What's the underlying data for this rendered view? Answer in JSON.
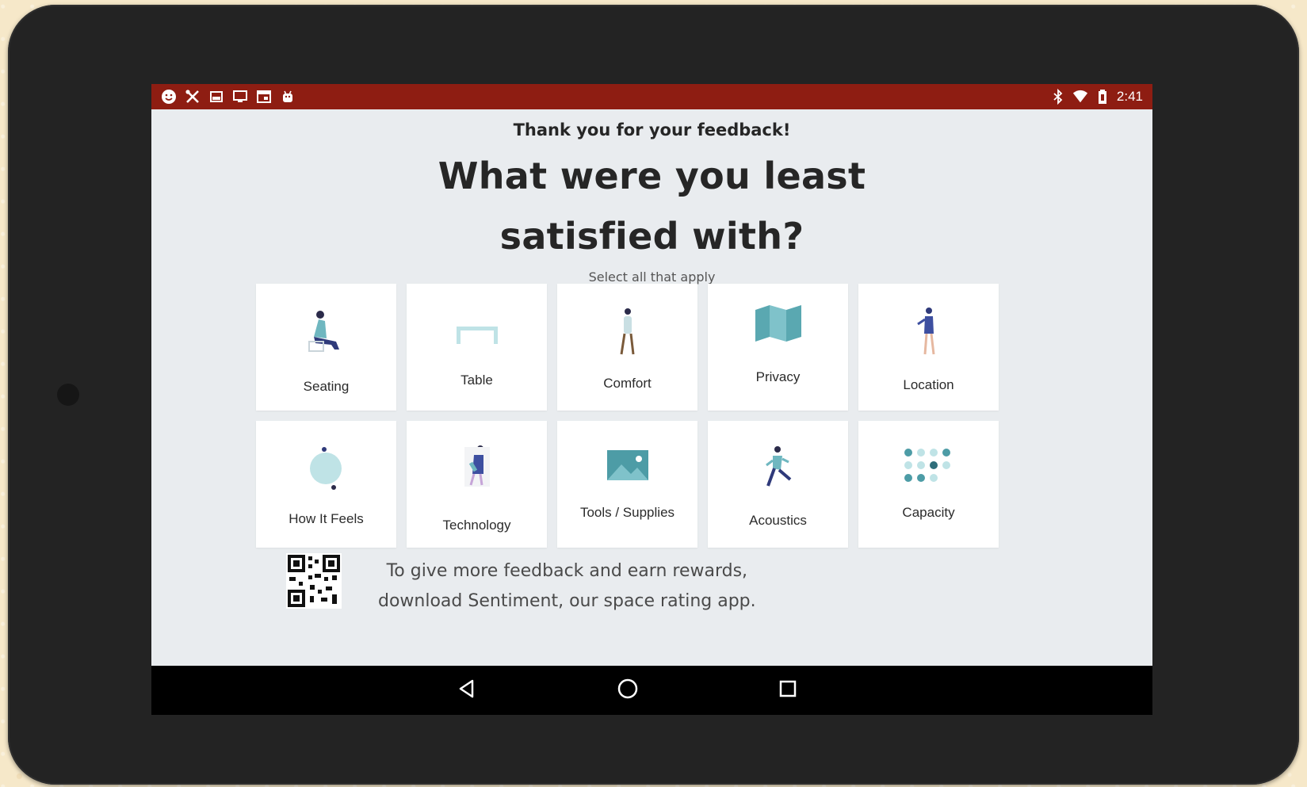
{
  "statusbar": {
    "time": "2:41",
    "left_icons": [
      "face-icon",
      "tools-icon",
      "image-icon",
      "screen-icon",
      "browser-icon",
      "android-icon"
    ],
    "right_icons": [
      "bluetooth-icon",
      "wifi-icon",
      "battery-icon"
    ]
  },
  "header": {
    "thanks": "Thank you for your feedback!",
    "question_line1": "What were you least",
    "question_line2": "satisfied with?",
    "subtitle": "Select all that apply"
  },
  "options": [
    {
      "label": "Seating",
      "icon": "seated-person-icon"
    },
    {
      "label": "Table",
      "icon": "table-icon"
    },
    {
      "label": "Comfort",
      "icon": "standing-person-icon"
    },
    {
      "label": "Privacy",
      "icon": "folding-map-icon"
    },
    {
      "label": "Location",
      "icon": "pointing-person-icon"
    },
    {
      "label": "How It Feels",
      "icon": "pendulum-icon"
    },
    {
      "label": "Technology",
      "icon": "person-with-device-icon"
    },
    {
      "label": "Tools / Supplies",
      "icon": "picture-icon"
    },
    {
      "label": "Acoustics",
      "icon": "running-person-icon"
    },
    {
      "label": "Capacity",
      "icon": "dot-grid-icon"
    }
  ],
  "footer": {
    "line1": "To give more feedback and earn rewards,",
    "line2": "download Sentiment, our space rating app.",
    "qr_icon": "qr-code-icon"
  },
  "navbar": {
    "icons": [
      "back-icon",
      "home-icon",
      "recents-icon"
    ]
  },
  "colors": {
    "statusbar": "#8e1d12",
    "screen_bg": "#e9ecef",
    "illustration_teal": "#6fb7c0",
    "illustration_navy": "#2f3a7a"
  }
}
